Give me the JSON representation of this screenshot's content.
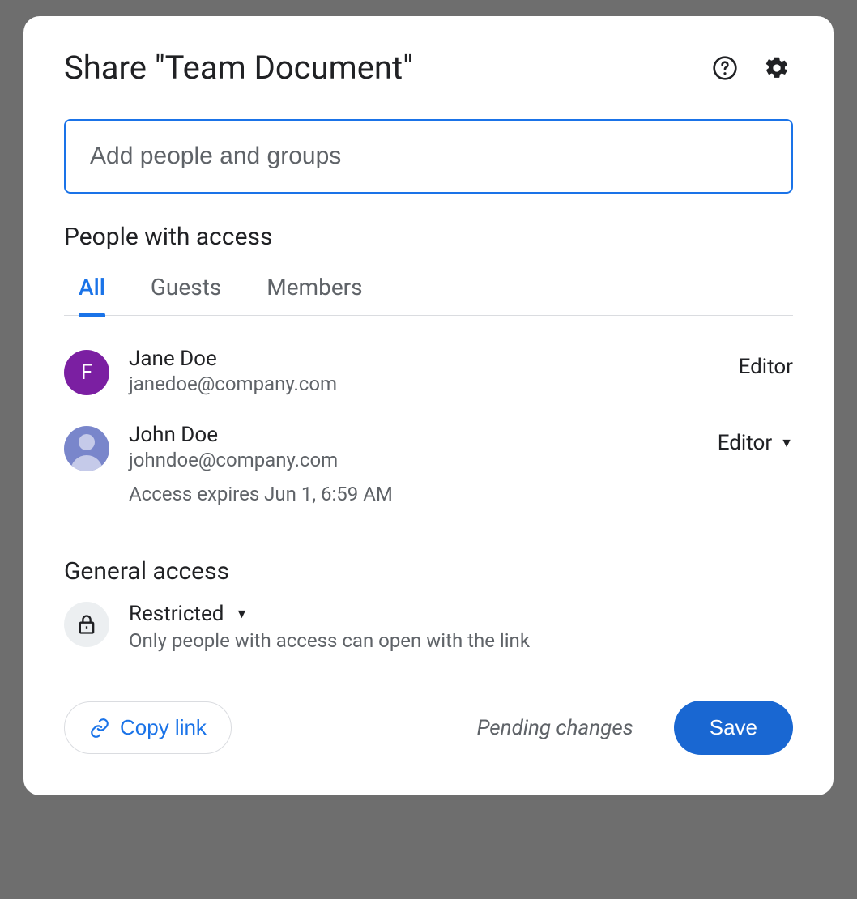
{
  "header": {
    "title": "Share \"Team Document\""
  },
  "input": {
    "placeholder": "Add people and groups"
  },
  "sections": {
    "people_title": "People with access",
    "general_title": "General access"
  },
  "tabs": [
    {
      "label": "All",
      "active": true
    },
    {
      "label": "Guests",
      "active": false
    },
    {
      "label": "Members",
      "active": false
    }
  ],
  "people": [
    {
      "avatar_type": "letter",
      "avatar_letter": "F",
      "name": "Jane Doe",
      "email": "janedoe@company.com",
      "role": "Editor",
      "role_dropdown": false,
      "note": ""
    },
    {
      "avatar_type": "silhouette",
      "avatar_letter": "",
      "name": "John Doe",
      "email": "johndoe@company.com",
      "role": "Editor",
      "role_dropdown": true,
      "note": "Access expires Jun 1, 6:59 AM"
    }
  ],
  "general_access": {
    "mode": "Restricted",
    "description": "Only people with access can open with the link"
  },
  "footer": {
    "copy_link": "Copy link",
    "pending": "Pending changes",
    "save": "Save"
  },
  "colors": {
    "primary": "#1a73e8",
    "save_bg": "#1967d2",
    "avatar1": "#7b1fa2",
    "avatar2": "#7986cb"
  }
}
